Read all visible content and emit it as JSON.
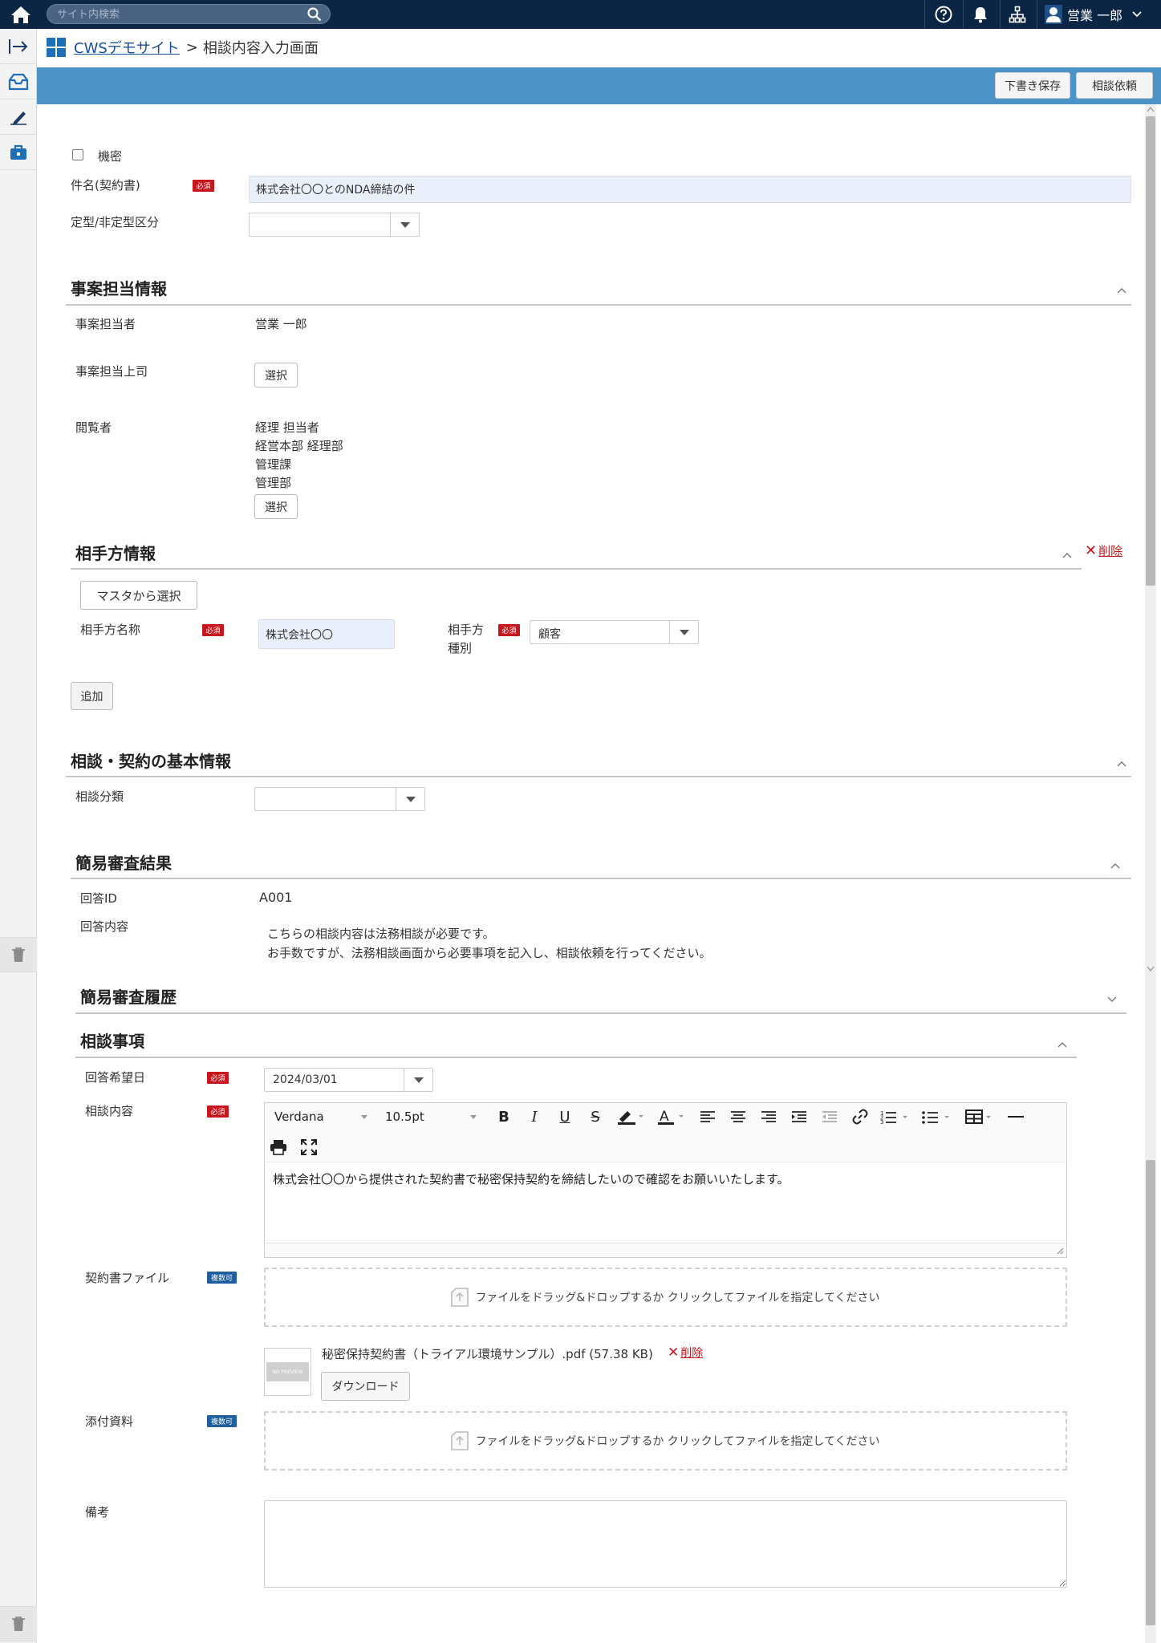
{
  "topbar": {
    "search_placeholder": "サイト内検索",
    "user_name": "営業 一郎"
  },
  "breadcrumb": {
    "site": "CWSデモサイト",
    "separator": ">",
    "current": "相談内容入力画面"
  },
  "header": {
    "draft_label": "下書き保存",
    "request_label": "相談依頼"
  },
  "form": {
    "confidential_label": "機密",
    "subject_label": "件名(契約書)",
    "subject_value": "株式会社〇〇とのNDA締結の件",
    "type_label": "定型/非定型区分",
    "type_value": "",
    "required_badge": "必須",
    "multi_badge": "複数可"
  },
  "case_section": {
    "title": "事案担当情報",
    "owner_label": "事案担当者",
    "owner_value": "営業 一郎",
    "boss_label": "事案担当上司",
    "select_label": "選択",
    "viewers_label": "閲覧者",
    "viewers": [
      "経理 担当者",
      "経営本部 経理部",
      "管理課",
      "管理部"
    ]
  },
  "party_section": {
    "title": "相手方情報",
    "delete_label": "削除",
    "master_button": "マスタから選択",
    "name_label": "相手方名称",
    "name_value": "株式会社〇〇",
    "kind_label_1": "相手方",
    "kind_label_2": "種別",
    "kind_value": "顧客",
    "add_label": "追加"
  },
  "basic_section": {
    "title": "相談・契約の基本情報",
    "category_label": "相談分類",
    "category_value": ""
  },
  "review_section": {
    "title": "簡易審査結果",
    "answer_id_label": "回答ID",
    "answer_id_value": "A001",
    "answer_label": "回答内容",
    "answer_line_1": "こちらの相談内容は法務相談が必要です。",
    "answer_line_2": "お手数ですが、法務相談画面から必要事項を記入し、相談依頼を行ってください。"
  },
  "history_section": {
    "title": "簡易審査履歴"
  },
  "consult_section": {
    "title": "相談事項",
    "due_label": "回答希望日",
    "due_value": "2024/03/01",
    "content_label": "相談内容",
    "font_value": "Verdana",
    "size_value": "10.5pt",
    "editor_text": "株式会社〇〇から提供された契約書で秘密保持契約を締結したいので確認をお願いいたします。",
    "contract_label": "契約書ファイル",
    "drop_text": "ファイルをドラッグ&ドロップするか クリックしてファイルを指定してください",
    "file_name": "秘密保持契約書（トライアル環境サンプル）.pdf",
    "file_size": "(57.38 KB)",
    "file_delete": "削除",
    "preview_label": "NO PREVIEW",
    "download_label": "ダウンロード",
    "attach_label": "添付資料",
    "note_label": "備考"
  },
  "colors": {
    "topbar": "#0b2545",
    "band": "#4c94c8",
    "required": "#c7161d",
    "multi": "#1f5f9f",
    "link": "#1a4f9c",
    "input_fill": "#e9f0fb"
  }
}
